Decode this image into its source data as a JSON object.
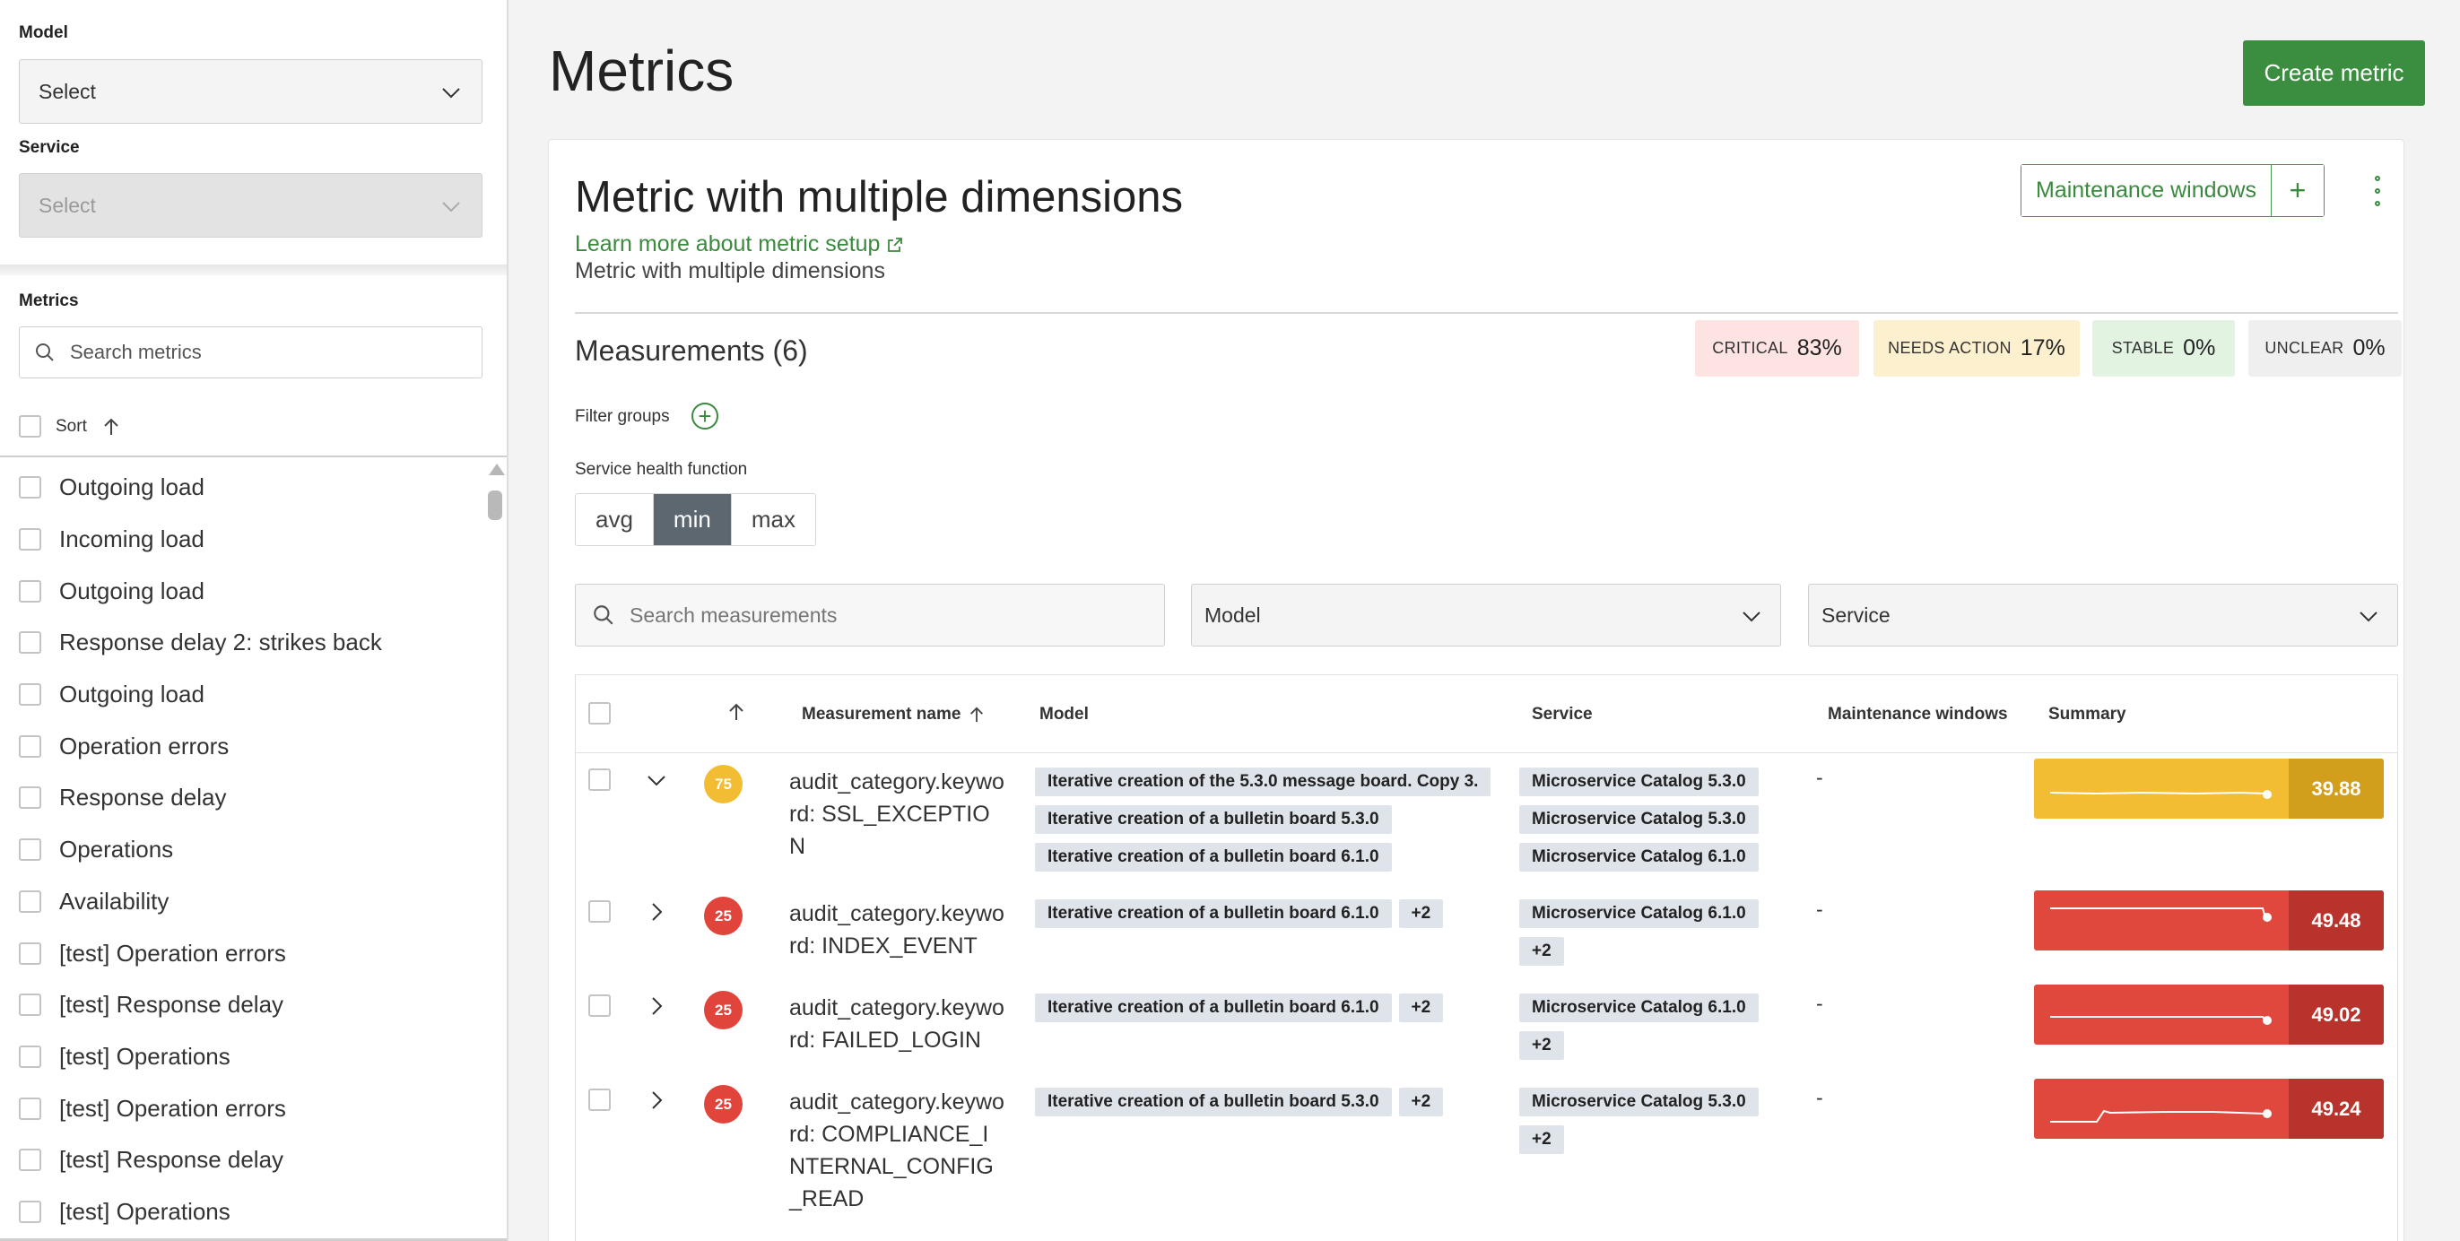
{
  "sidebar": {
    "model_label": "Model",
    "model_value": "Select",
    "service_label": "Service",
    "service_value": "Select",
    "metrics_label": "Metrics",
    "search_placeholder": "Search metrics",
    "sort_label": "Sort",
    "metrics": [
      "Outgoing load",
      "Incoming load",
      "Outgoing load",
      "Response delay 2: strikes back",
      "Outgoing load",
      "Operation errors",
      "Response delay",
      "Operations",
      "Availability",
      "[test] Operation errors",
      "[test] Response delay",
      "[test] Operations",
      "[test] Operation errors",
      "[test] Response delay",
      "[test] Operations"
    ]
  },
  "header": {
    "title": "Metrics",
    "create_button": "Create metric"
  },
  "metric": {
    "title": "Metric with multiple dimensions",
    "learn_link": "Learn more about metric setup",
    "description": "Metric with multiple dimensions",
    "maintenance_button": "Maintenance windows",
    "maintenance_add": "+"
  },
  "measurements": {
    "title": "Measurements (6)",
    "status": [
      {
        "label": "CRITICAL",
        "value": "83%",
        "color": "#fde3e1"
      },
      {
        "label": "NEEDS ACTION",
        "value": "17%",
        "color": "#fdf0cf"
      },
      {
        "label": "STABLE",
        "value": "0%",
        "color": "#e2f3e2"
      },
      {
        "label": "UNCLEAR",
        "value": "0%",
        "color": "#efefef"
      }
    ],
    "filter_groups_label": "Filter groups",
    "health_label": "Service health function",
    "health_options": [
      "avg",
      "min",
      "max"
    ],
    "health_selected": "min",
    "search_placeholder": "Search measurements",
    "model_filter": "Model",
    "service_filter": "Service"
  },
  "table": {
    "headers": {
      "name": "Measurement name",
      "model": "Model",
      "service": "Service",
      "maintenance": "Maintenance windows",
      "summary": "Summary"
    },
    "rows": [
      {
        "score": "75",
        "score_color": "#f2bd33",
        "name": "audit_category.keyword: SSL_EXCEPTION",
        "models": [
          [
            "Iterative creation of the 5.3.0 message board. Copy 3."
          ],
          [
            "Iterative creation of a bulletin board 5.3.0"
          ],
          [
            "Iterative creation of a bulletin board 6.1.0"
          ]
        ],
        "services": [
          [
            "Microservice Catalog 5.3.0"
          ],
          [
            "Microservice Catalog 5.3.0"
          ],
          [
            "Microservice Catalog 6.1.0"
          ]
        ],
        "maintenance": "-",
        "summary_value": "39.88",
        "summary_color": "#f2bd33",
        "summary_dark": "#d19f1c",
        "expanded": true
      },
      {
        "score": "25",
        "score_color": "#e0443a",
        "name": "audit_category.keyword: INDEX_EVENT",
        "models": [
          [
            "Iterative creation of a bulletin board 6.1.0",
            "+2"
          ]
        ],
        "services": [
          [
            "Microservice Catalog 6.1.0"
          ],
          [
            "+2"
          ]
        ],
        "maintenance": "-",
        "summary_value": "49.48",
        "summary_color": "#e0483e",
        "summary_dark": "#b8332c",
        "expanded": false
      },
      {
        "score": "25",
        "score_color": "#e0443a",
        "name": "audit_category.keyword: FAILED_LOGIN",
        "models": [
          [
            "Iterative creation of a bulletin board 6.1.0",
            "+2"
          ]
        ],
        "services": [
          [
            "Microservice Catalog 6.1.0"
          ],
          [
            "+2"
          ]
        ],
        "maintenance": "-",
        "summary_value": "49.02",
        "summary_color": "#e0483e",
        "summary_dark": "#b8332c",
        "expanded": false
      },
      {
        "score": "25",
        "score_color": "#e0443a",
        "name": "audit_category.keyword: COMPLIANCE_INTERNAL_CONFIG_READ",
        "models": [
          [
            "Iterative creation of a bulletin board 5.3.0",
            "+2"
          ]
        ],
        "services": [
          [
            "Microservice Catalog 5.3.0"
          ],
          [
            "+2"
          ]
        ],
        "maintenance": "-",
        "summary_value": "49.24",
        "summary_color": "#e0483e",
        "summary_dark": "#b8332c",
        "expanded": false
      }
    ]
  }
}
